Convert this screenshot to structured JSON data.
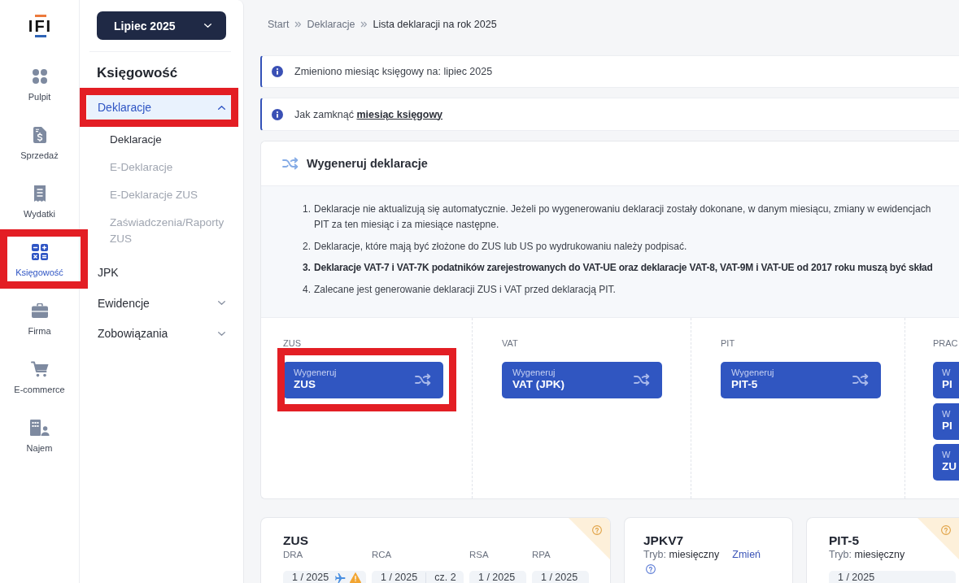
{
  "rail": {
    "logo": "IFI",
    "items": [
      {
        "label": "Pulpit",
        "selected": false,
        "highlighted": false
      },
      {
        "label": "Sprzedaż",
        "selected": false,
        "highlighted": false
      },
      {
        "label": "Wydatki",
        "selected": false,
        "highlighted": false
      },
      {
        "label": "Księgowość",
        "selected": true,
        "highlighted": true
      },
      {
        "label": "Firma",
        "selected": false,
        "highlighted": false
      },
      {
        "label": "E-commerce",
        "selected": false,
        "highlighted": false
      },
      {
        "label": "Najem",
        "selected": false,
        "highlighted": false
      }
    ]
  },
  "sidebar": {
    "period": "Lipiec 2025",
    "heading": "Księgowość",
    "menu": [
      {
        "kind": "group",
        "label": "Deklaracje",
        "selected": true,
        "expanded": true,
        "highlighted": true,
        "children": [
          {
            "label": "Deklaracje",
            "selected": true
          },
          {
            "label": "E-Deklaracje",
            "selected": false
          },
          {
            "label": "E-Deklaracje ZUS",
            "selected": false
          },
          {
            "label": "Zaświadczenia/Raporty ZUS",
            "selected": false
          }
        ]
      },
      {
        "kind": "link",
        "label": "JPK",
        "selected": false,
        "highlighted": false
      },
      {
        "kind": "group",
        "label": "Ewidencje",
        "selected": false,
        "expanded": false,
        "highlighted": false
      },
      {
        "kind": "group",
        "label": "Zobowiązania",
        "selected": false,
        "expanded": false,
        "highlighted": false
      }
    ]
  },
  "breadcrumb": [
    {
      "label": "Start",
      "current": false
    },
    {
      "label": "Deklaracje",
      "current": false
    },
    {
      "label": "Lista deklaracji na rok 2025",
      "current": true
    }
  ],
  "alerts": [
    {
      "text": "Zmieniono miesiąc księgowy na: lipiec 2025"
    },
    {
      "text": "Jak zamknąć",
      "link": "miesiąc księgowy"
    }
  ],
  "generator": {
    "title": "Wygeneruj deklaracje",
    "notes": [
      {
        "number": "1.",
        "bold": false,
        "lines": [
          "Deklaracje nie aktualizują się automatycznie. Jeżeli po wygenerowaniu deklaracji zostały dokonane, w danym miesiącu, zmiany w ewidencjach",
          "PIT za ten miesiąc i za miesiące następne."
        ]
      },
      {
        "number": "2.",
        "bold": false,
        "lines": [
          "Deklaracje, które mają być złożone do ZUS lub US po wydrukowaniu należy podpisać."
        ]
      },
      {
        "number": "3.",
        "bold": true,
        "lines": [
          "Deklaracje VAT-7 i VAT-7K podatników zarejestrowanych do VAT-UE oraz deklaracje VAT-8, VAT-9M i VAT-UE od 2017 roku muszą być skład"
        ]
      },
      {
        "number": "4.",
        "bold": false,
        "lines": [
          "Zalecane jest generowanie deklaracji ZUS i VAT przed deklaracją PIT."
        ]
      }
    ],
    "columns": [
      {
        "label": "ZUS",
        "buttons": [
          {
            "caption": "Wygeneruj",
            "value": "ZUS",
            "highlighted": true
          }
        ]
      },
      {
        "label": "VAT",
        "buttons": [
          {
            "caption": "Wygeneruj",
            "value": "VAT (JPK)",
            "highlighted": false
          }
        ]
      },
      {
        "label": "PIT",
        "buttons": [
          {
            "caption": "Wygeneruj",
            "value": "PIT-5",
            "highlighted": false
          }
        ]
      },
      {
        "label": "PRAC",
        "buttons": [
          {
            "caption": "W",
            "value": "PI",
            "highlighted": false
          },
          {
            "caption": "W",
            "value": "PI",
            "highlighted": false
          },
          {
            "caption": "W",
            "value": "ZU",
            "highlighted": false
          }
        ]
      }
    ]
  },
  "summary_cards": [
    {
      "title": "ZUS",
      "flag": true,
      "help": false,
      "fields": [
        {
          "label": "DRA",
          "chip": {
            "value": "1 / 2025",
            "sent": true,
            "warning": true
          }
        },
        {
          "label": "RCA",
          "chip": {
            "value": "1 / 2025",
            "part": "cz. 2",
            "sent": false,
            "warning": false
          }
        },
        {
          "label": "RSA",
          "chip": {
            "value": "1 / 2025",
            "sent": false,
            "warning": false
          }
        },
        {
          "label": "RPA",
          "chip": {
            "value": "1 / 2025",
            "sent": false,
            "warning": false
          }
        }
      ]
    },
    {
      "title": "JPKV7",
      "flag": false,
      "help": true,
      "mode_label": "Tryb:",
      "mode": "miesięczny",
      "link": "Zmień"
    },
    {
      "title": "PIT-5",
      "flag": true,
      "help": false,
      "mode_label": "Tryb:",
      "mode": "miesięczny",
      "fields": [
        {
          "chip": {
            "value": "1 / 2025",
            "sent": false,
            "warning": false
          }
        }
      ]
    }
  ]
}
